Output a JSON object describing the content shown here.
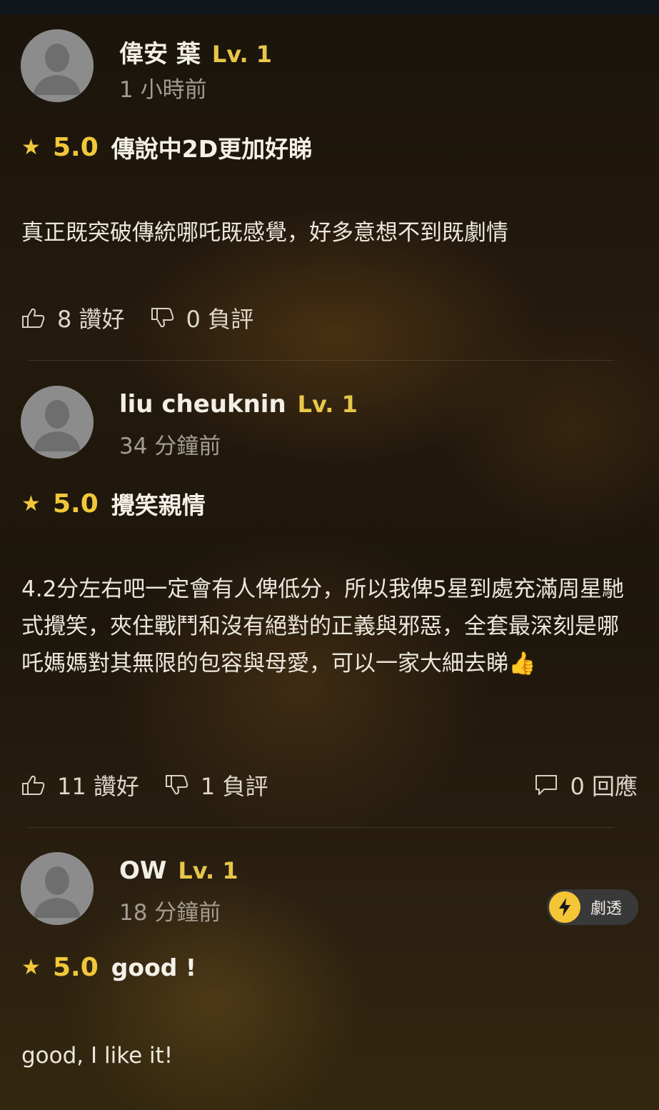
{
  "reviews": [
    {
      "username": "偉安 葉",
      "level": "Lv. 1",
      "time": "1 小時前",
      "score": "5.0",
      "title": "傳說中2D更加好睇",
      "body": "真正既突破傳統哪吒既感覺，好多意想不到既劇情",
      "likes": "8 讚好",
      "dislikes": "0 負評"
    },
    {
      "username": "liu cheuknin",
      "level": "Lv. 1",
      "time": "34 分鐘前",
      "score": "5.0",
      "title": "攪笑親情",
      "body": "4.2分左右吧一定會有人俾低分，所以我俾5星到處充滿周星馳式攪笑，夾住戰鬥和沒有絕對的正義與邪惡，全套最深刻是哪吒媽媽對其無限的包容與母愛，可以一家大細去睇👍",
      "likes": "11 讚好",
      "dislikes": "1 負評",
      "replies": "0 回應"
    },
    {
      "username": "OW",
      "level": "Lv. 1",
      "time": "18 分鐘前",
      "score": "5.0",
      "title": "good !",
      "body": "good, I like it!",
      "spoiler_label": "劇透"
    }
  ],
  "colors": {
    "accent": "#f1c73a",
    "level": "#e7c64a",
    "time": "#a39d91",
    "spoiler_bolt": "#f4c534"
  },
  "icons": {
    "star": "star-icon",
    "like": "thumbs-up-icon",
    "dislike": "thumbs-down-icon",
    "reply": "comment-icon",
    "spoiler": "lightning-icon",
    "avatar": "default-avatar-icon"
  }
}
